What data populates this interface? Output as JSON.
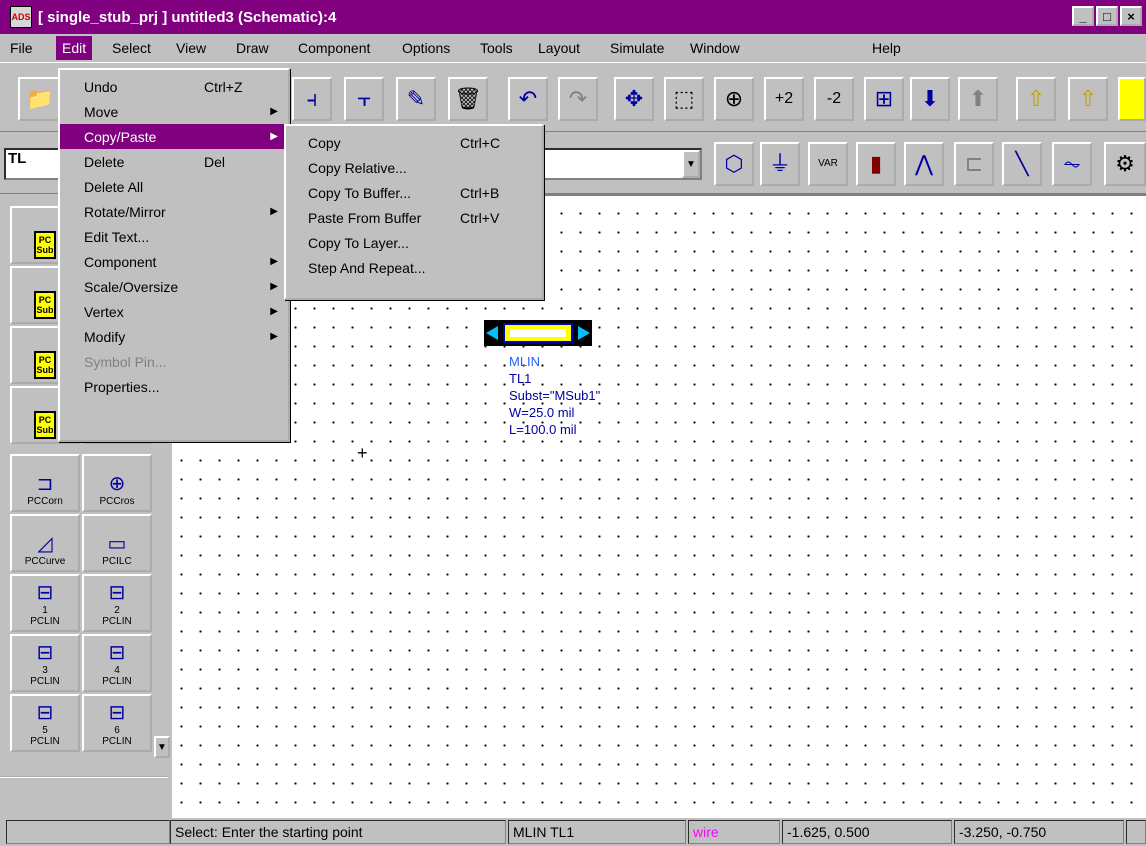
{
  "window": {
    "title": "[ single_stub_prj ] untitled3 (Schematic):4",
    "minimize_label": "_",
    "maximize_label": "□",
    "close_label": "×"
  },
  "menubar": {
    "items": [
      {
        "label": "File"
      },
      {
        "label": "Edit"
      },
      {
        "label": "Select"
      },
      {
        "label": "View"
      },
      {
        "label": "Draw"
      },
      {
        "label": "Component"
      },
      {
        "label": "Options"
      },
      {
        "label": "Tools"
      },
      {
        "label": "Layout"
      },
      {
        "label": "Simulate"
      },
      {
        "label": "Window"
      },
      {
        "label": "Help"
      }
    ]
  },
  "toolbar": {
    "buttons": [
      "open-icon",
      "insert-component-icon",
      "insert-pin-icon",
      "edit-icon",
      "delete-icon",
      "undo-icon",
      "redo-icon",
      "move-icon",
      "zoom-area-icon",
      "zoom-icon",
      "zoom-in-icon",
      "zoom-out-icon",
      "fit-icon",
      "push-icon",
      "pop-icon",
      "arrow-up-icon",
      "arrow-up-outline-icon"
    ]
  },
  "toolbar2": {
    "palette_combo_value": "TL",
    "component_combo_value": "",
    "buttons": [
      "port-icon",
      "ground-icon",
      "var-icon",
      "data-icon",
      "sparam-icon",
      "rlc-icon",
      "line-icon",
      "resistor-icon"
    ],
    "var_label": "VAR"
  },
  "palette": {
    "items": [
      {
        "label": "PC Sub"
      },
      {
        "label": "PC Sub"
      },
      {
        "label": "PC Sub"
      },
      {
        "label": "PC Sub"
      },
      {
        "label": "PCCorn"
      },
      {
        "label": "PCCros"
      },
      {
        "label": "PCCurve"
      },
      {
        "label": "PCILC"
      },
      {
        "label": "PCLIN",
        "num": "1"
      },
      {
        "label": "PCLIN",
        "num": "2"
      },
      {
        "label": "PCLIN",
        "num": "3"
      },
      {
        "label": "PCLIN",
        "num": "4"
      },
      {
        "label": "PCLIN",
        "num": "5"
      },
      {
        "label": "PCLIN",
        "num": "6"
      }
    ],
    "sub_text": "PC\nSub"
  },
  "edit_menu": {
    "items": [
      {
        "label": "Undo",
        "shortcut": "Ctrl+Z"
      },
      {
        "label": "Move",
        "submenu": true
      },
      {
        "label": "Copy/Paste",
        "submenu": true
      },
      {
        "label": "Delete",
        "shortcut": "Del"
      },
      {
        "label": "Delete All"
      },
      {
        "label": "Rotate/Mirror",
        "submenu": true
      },
      {
        "label": "Edit Text..."
      },
      {
        "label": "Component",
        "submenu": true
      },
      {
        "label": "Scale/Oversize",
        "submenu": true
      },
      {
        "label": "Vertex",
        "submenu": true
      },
      {
        "label": "Modify",
        "submenu": true
      },
      {
        "label": "Symbol Pin..."
      },
      {
        "label": "Properties..."
      }
    ]
  },
  "copy_paste_menu": {
    "items": [
      {
        "label": "Copy",
        "shortcut": "Ctrl+C"
      },
      {
        "label": "Copy Relative..."
      },
      {
        "label": "Copy To Buffer...",
        "shortcut": "Ctrl+B"
      },
      {
        "label": "Paste From Buffer",
        "shortcut": "Ctrl+V"
      },
      {
        "label": "Copy To Layer..."
      },
      {
        "label": "Step And Repeat..."
      }
    ]
  },
  "component": {
    "type": "MLIN",
    "name": "TL1",
    "subst": "Subst=\"MSub1\"",
    "w": "W=25.0 mil",
    "l": "L=100.0 mil"
  },
  "statusbar": {
    "message": "Select: Enter the starting point",
    "component": "MLIN TL1",
    "layer": "wire",
    "coord1": "-1.625, 0.500",
    "coord2": "-3.250, -0.750"
  },
  "colors": {
    "title_bg": "#800080",
    "menu_highlight": "#800080",
    "layer_text": "#ff00ff",
    "component_text": "#0000a0"
  }
}
